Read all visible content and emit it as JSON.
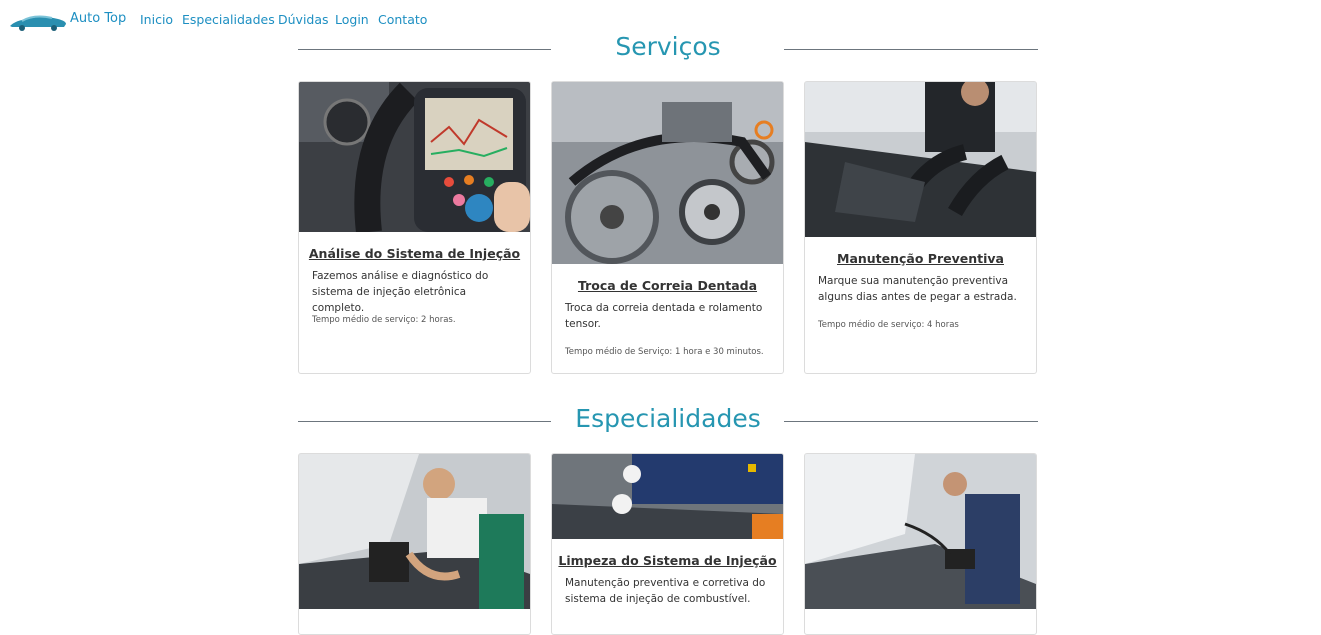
{
  "nav": {
    "brand": "Auto Top",
    "links": [
      "Inicio",
      "Especialidades",
      "Dúvidas",
      "Login",
      "Contato"
    ]
  },
  "sections": [
    {
      "title": "Serviços",
      "cards": [
        {
          "title": "Análise do Sistema de Injeção",
          "description": "Fazemos análise e diagnóstico do sistema de injeção eletrônica completo.",
          "time": "Tempo médio de serviço: 2 horas.",
          "image": "diagnostic-scanner-photo"
        },
        {
          "title": "Troca de Correia Dentada",
          "description": "Troca da correia dentada e rolamento tensor.",
          "time": "Tempo médio de Serviço: 1 hora e 30 minutos.",
          "image": "timing-belt-engine-photo"
        },
        {
          "title": "Manutenção Preventiva",
          "description": "Marque sua manutenção preventiva alguns dias antes de pegar a estrada.",
          "time": "Tempo médio de serviço: 4 horas",
          "image": "mechanic-under-hood-photo"
        }
      ]
    },
    {
      "title": "Especialidades",
      "cards": [
        {
          "title": "",
          "description": "",
          "time": "",
          "image": "mechanic-laptop-photo"
        },
        {
          "title": "Limpeza do Sistema de Injeção",
          "description": "Manutenção preventiva e corretiva do sistema de injeção de combustível.",
          "time": "",
          "image": "injection-cleaning-photo"
        },
        {
          "title": "",
          "description": "",
          "time": "",
          "image": "mechanic-tablet-photo"
        }
      ]
    }
  ],
  "colors": {
    "accent": "#2696b1",
    "link": "#1d8fc2"
  }
}
